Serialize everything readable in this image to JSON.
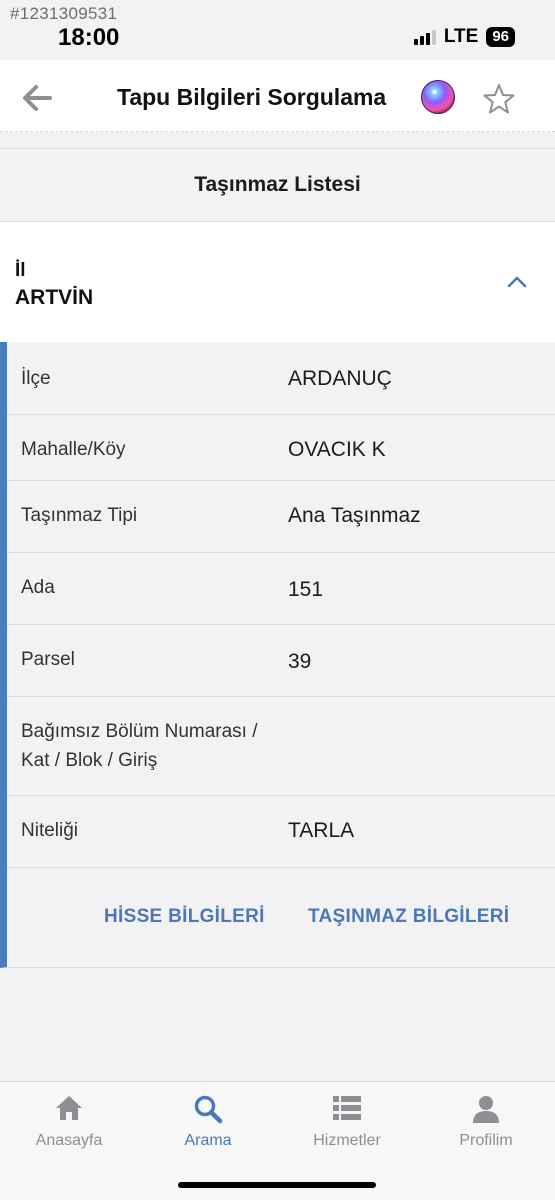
{
  "watermark": "#1231309531",
  "status_bar": {
    "time": "18:00",
    "network": "LTE",
    "battery": "96"
  },
  "nav": {
    "title": "Tapu Bilgileri Sorgulama"
  },
  "section": {
    "title": "Taşınmaz Listesi"
  },
  "province": {
    "label": "İl",
    "value": "ARTVİN"
  },
  "details": [
    {
      "label": "İlçe",
      "value": "ARDANUÇ"
    },
    {
      "label": "Mahalle/Köy",
      "value": "OVACIK K"
    },
    {
      "label": "Taşınmaz Tipi",
      "value": "Ana Taşınmaz"
    },
    {
      "label": "Ada",
      "value": "151"
    },
    {
      "label": "Parsel",
      "value": "39"
    },
    {
      "label": "Bağımsız Bölüm Numarası /",
      "label2": "Kat / Blok / Giriş",
      "value": ""
    },
    {
      "label": "Niteliği",
      "value": "TARLA"
    }
  ],
  "actions": {
    "share_info": "HİSSE BİLGİLERİ",
    "property_info": "TAŞINMAZ BİLGİLERİ"
  },
  "tabs": [
    {
      "label": "Anasayfa",
      "icon": "home-icon",
      "active": false
    },
    {
      "label": "Arama",
      "icon": "search-icon",
      "active": true
    },
    {
      "label": "Hizmetler",
      "icon": "list-icon",
      "active": false
    },
    {
      "label": "Profilim",
      "icon": "person-icon",
      "active": false
    }
  ],
  "colors": {
    "accent": "#4a78b8",
    "card_border": "#4a7cc0",
    "background": "#f2f2f4",
    "inactive_tab": "#8e8e93"
  }
}
